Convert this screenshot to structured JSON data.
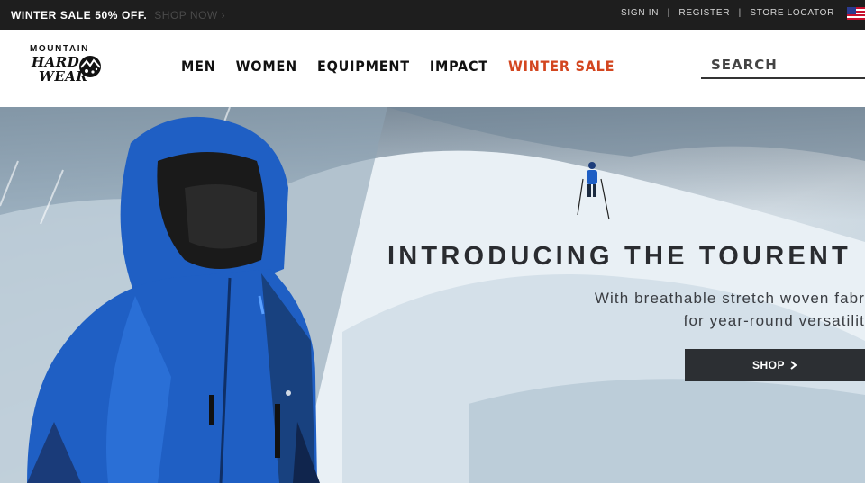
{
  "promo_bar": {
    "message": "WINTER SALE 50% OFF.",
    "cta": "SHOP NOW ›"
  },
  "utility_nav": {
    "sign_in": "SIGN IN",
    "register": "REGISTER",
    "store_locator": "STORE LOCATOR",
    "separator": "|",
    "region_flag": "us-flag-icon"
  },
  "logo": {
    "line1": "MOUNTAIN",
    "line2": "HARD",
    "line3": "WEAR"
  },
  "main_nav": {
    "items": [
      {
        "label": "MEN"
      },
      {
        "label": "WOMEN"
      },
      {
        "label": "EQUIPMENT"
      },
      {
        "label": "IMPACT"
      },
      {
        "label": "WINTER SALE",
        "color": "#d3461f"
      }
    ]
  },
  "search": {
    "placeholder": "SEARCH"
  },
  "hero": {
    "headline": "INTRODUCING THE TOURENT",
    "subline1": "With breathable stretch woven fabr",
    "subline2": "for year-round versatilit",
    "cta_label": "SHOP",
    "cta_icon": "chevron-right-icon"
  },
  "colors": {
    "topbar": "#1e1e1e",
    "accent_sale": "#d3461f",
    "cta_bg": "#2c2f33",
    "jacket_blue": "#1f5fc4"
  }
}
